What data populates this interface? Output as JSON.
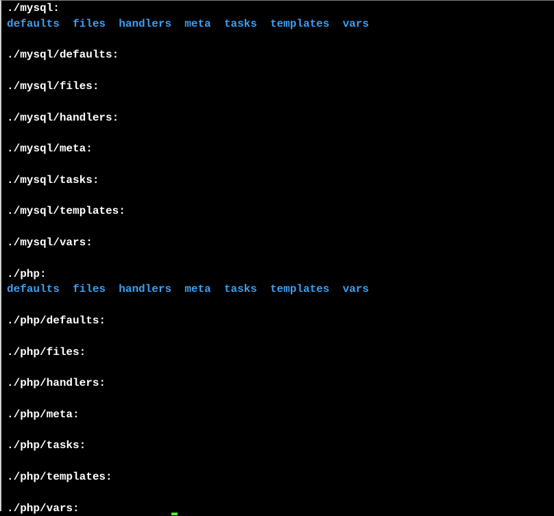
{
  "partial_top": "./mysql:",
  "mysql_dirs": [
    "defaults",
    "files",
    "handlers",
    "meta",
    "tasks",
    "templates",
    "vars"
  ],
  "mysql_subs": [
    "./mysql/defaults:",
    "./mysql/files:",
    "./mysql/handlers:",
    "./mysql/meta:",
    "./mysql/tasks:",
    "./mysql/templates:",
    "./mysql/vars:"
  ],
  "php_header": "./php:",
  "php_dirs": [
    "defaults",
    "files",
    "handlers",
    "meta",
    "tasks",
    "templates",
    "vars"
  ],
  "php_subs": [
    "./php/defaults:",
    "./php/files:",
    "./php/handlers:",
    "./php/meta:",
    "./php/tasks:",
    "./php/templates:",
    "./php/vars:"
  ]
}
